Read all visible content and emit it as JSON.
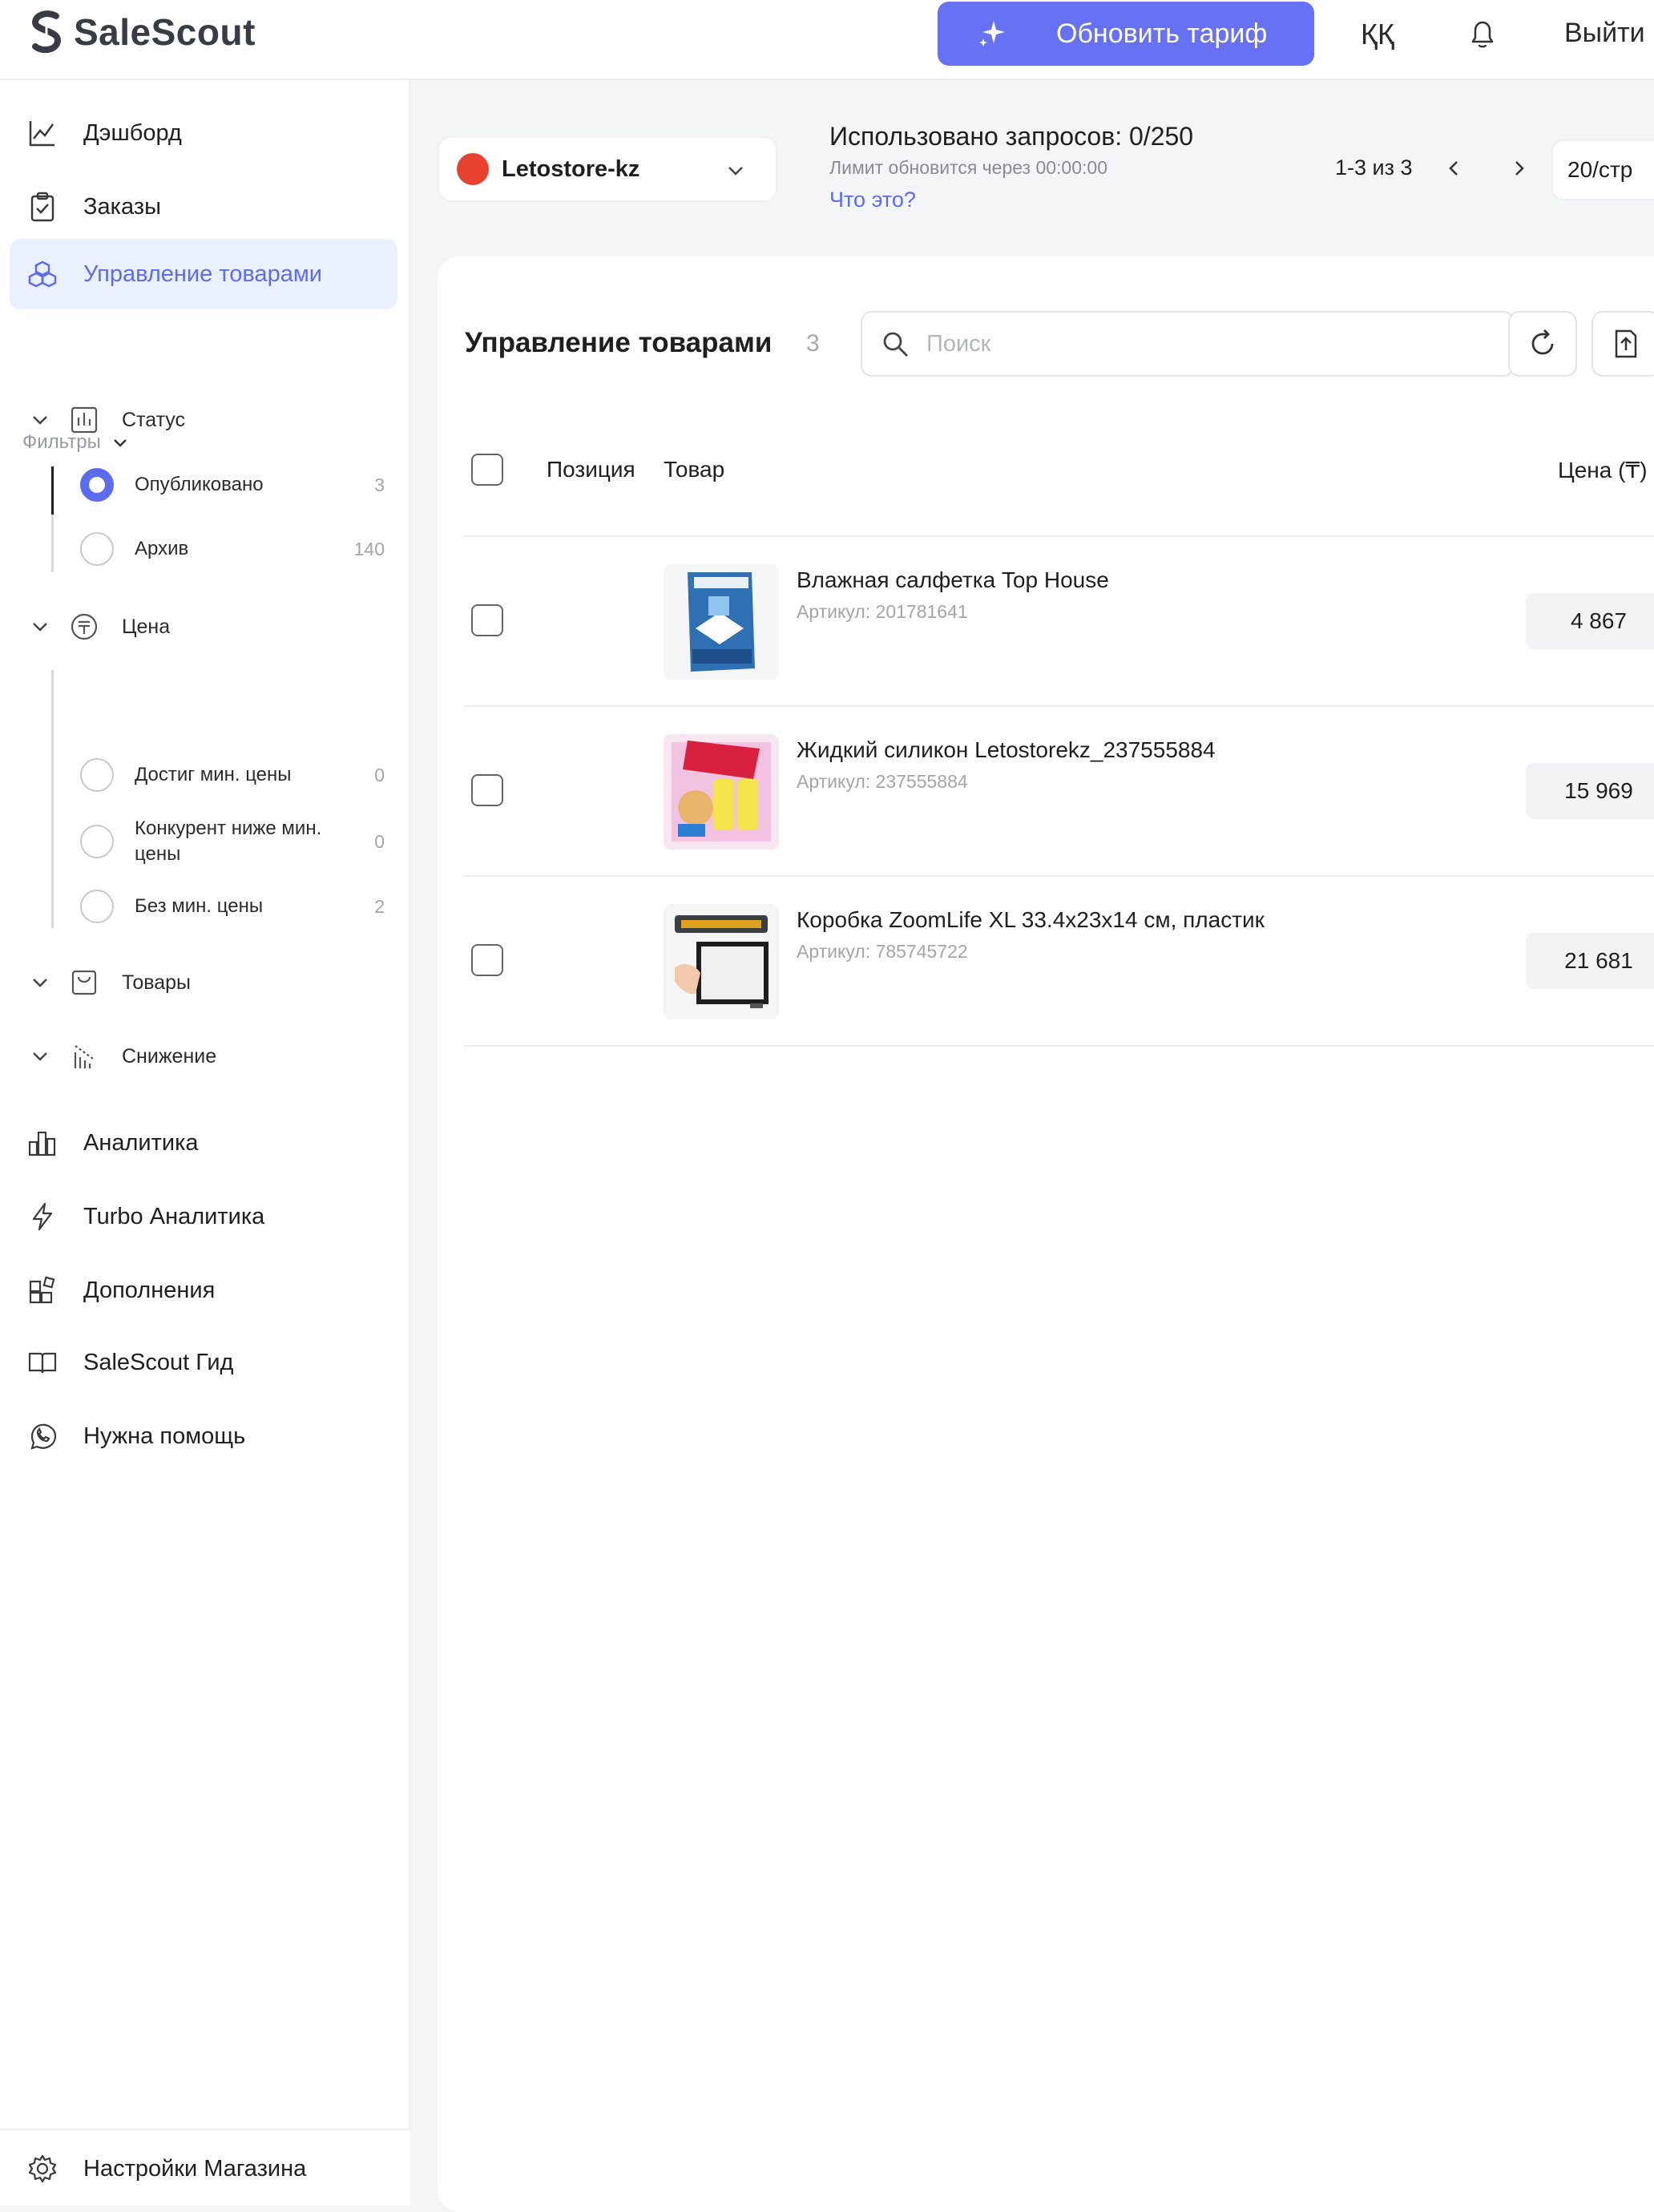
{
  "header": {
    "logo_text": "SaleScout",
    "upgrade_label": "Обновить тариф",
    "lang_label": "ҚҚ",
    "logout_label": "Выйти"
  },
  "sidebar": {
    "nav_top": [
      {
        "label": "Дэшборд",
        "icon": "chart-line-icon"
      },
      {
        "label": "Заказы",
        "icon": "clipboard-check-icon"
      },
      {
        "label": "Управление товарами",
        "icon": "boxes-icon",
        "active": true
      }
    ],
    "filters_label": "Фильтры",
    "filter_groups": {
      "status": {
        "label": "Статус",
        "options": [
          {
            "label": "Опубликовано",
            "count": "3",
            "selected": true
          },
          {
            "label": "Архив",
            "count": "140",
            "selected": false
          }
        ]
      },
      "price": {
        "label": "Цена",
        "options": [
          {
            "label": "Достиг мин. цены",
            "count": "0"
          },
          {
            "label": "Конкурент ниже мин. цены",
            "count": "0"
          },
          {
            "label": "Без мин. цены",
            "count": "2"
          }
        ]
      },
      "products": {
        "label": "Товары"
      },
      "decrease": {
        "label": "Снижение"
      }
    },
    "nav_bottom": [
      {
        "label": "Аналитика",
        "icon": "analytics-icon"
      },
      {
        "label": "Turbo Аналитика",
        "icon": "lightning-icon"
      },
      {
        "label": "Дополнения",
        "icon": "puzzle-icon"
      },
      {
        "label": "SaleScout Гид",
        "icon": "book-icon"
      },
      {
        "label": "Нужна помощь",
        "icon": "whatsapp-icon"
      }
    ],
    "footer_label": "Настройки Магазина"
  },
  "topbar": {
    "store_name": "Letostore-kz",
    "usage_title": "Использовано запросов: 0/250",
    "usage_sub": "Лимит обновится через 00:00:00",
    "usage_link": "Что это?",
    "pager_text": "1-3 из 3",
    "per_page": "20/стр"
  },
  "card": {
    "title": "Управление товарами",
    "count": "3",
    "search_placeholder": "Поиск",
    "columns": {
      "position": "Позиция",
      "product": "Товар",
      "price": "Цена (₸)"
    },
    "rows": [
      {
        "name": "Влажная салфетка Top House",
        "sku": "Артикул: 201781641",
        "price": "4 867"
      },
      {
        "name": "Жидкий силикон Letostorekz_237555884",
        "sku": "Артикул: 237555884",
        "price": "15 969"
      },
      {
        "name": "Коробка ZoomLife XL 33.4x23x14 см, пластик",
        "sku": "Артикул: 785745722",
        "price": "21 681"
      }
    ]
  },
  "colors": {
    "accent": "#6671f3",
    "active_bg": "#eaf0fd",
    "store_logo": "#e8412f"
  }
}
